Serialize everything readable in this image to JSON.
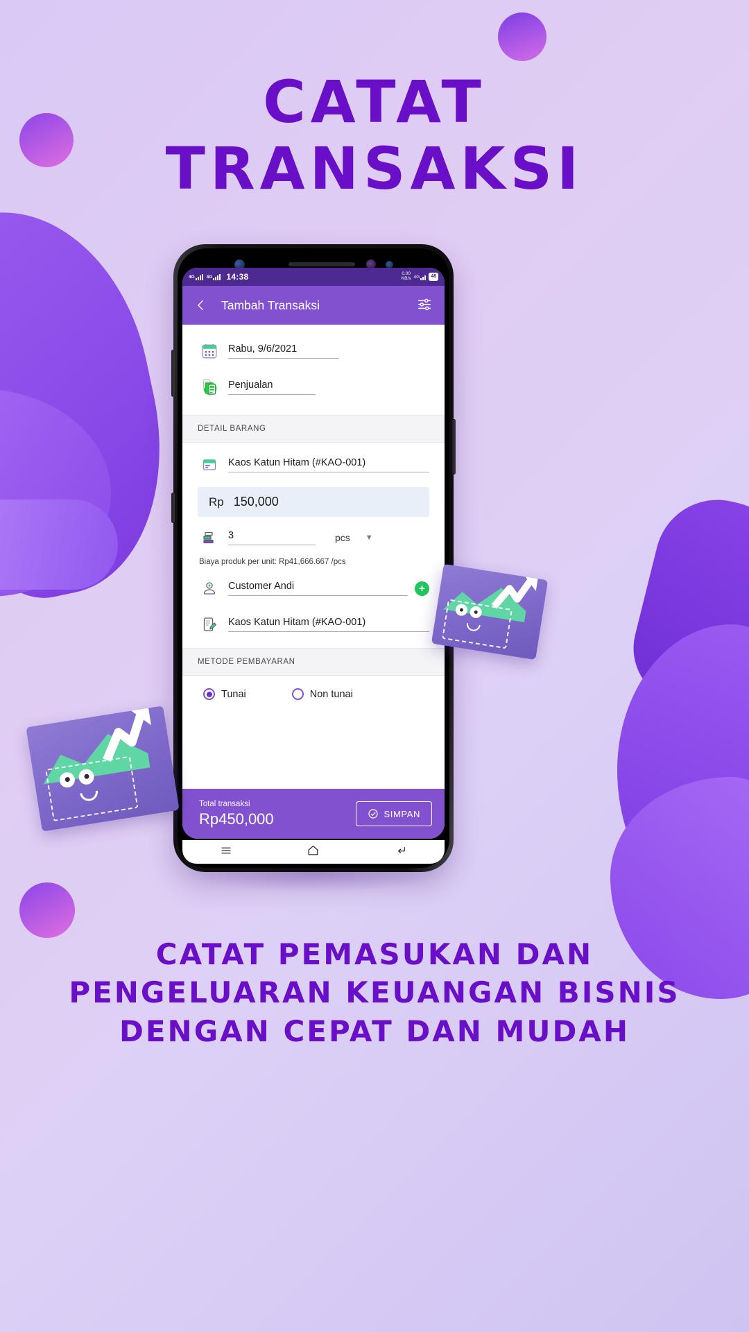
{
  "poster": {
    "headline_line1": "CATAT",
    "headline_line2": "TRANSAKSI",
    "caption_line1": "CATAT PEMASUKAN DAN",
    "caption_line2": "PENGELUARAN KEUANGAN BISNIS",
    "caption_line3": "DENGAN CEPAT DAN MUDAH",
    "brand_purple": "#6a0fc8",
    "background_start": "#d9c9f5",
    "background_end": "#cfc3f2"
  },
  "phone": {
    "status_bar": {
      "network_1": "4G",
      "network_2": "4G",
      "time": "14:38",
      "data_rate_value": "0.00",
      "data_rate_unit": "KB/s",
      "network_right": "4G",
      "battery": "48",
      "background": "#4d2a92"
    },
    "app_bar": {
      "back_icon": "chevron-left-icon",
      "title": "Tambah Transaksi",
      "filter_icon": "tune-sliders-icon",
      "background": "#8251d0"
    },
    "form": {
      "date_icon": "calendar-icon",
      "date_value": "Rabu, 9/6/2021",
      "category_icon": "invoice-icon",
      "category_value": "Penjualan",
      "section_item_header": "DETAIL BARANG",
      "item_icon": "box-icon",
      "item_value": "Kaos Katun Hitam (#KAO-001)",
      "price_currency": "Rp",
      "price_value": "150,000",
      "qty_icon": "stack-icon",
      "qty_value": "3",
      "qty_unit": "pcs",
      "qty_unit_caret": "chevron-down-icon",
      "cost_note": "Biaya produk per unit: Rp41,666.667 /pcs",
      "customer_icon": "customer-icon",
      "customer_value": "Customer Andi",
      "add_customer_icon": "plus-icon",
      "description_icon": "note-edit-icon",
      "description_value": "Kaos Katun Hitam (#KAO-001)",
      "section_payment_header": "METODE PEMBAYARAN",
      "payment_options": [
        {
          "label": "Tunai",
          "selected": true
        },
        {
          "label": "Non tunai",
          "selected": false
        }
      ]
    },
    "total_bar": {
      "label": "Total transaksi",
      "amount": "Rp450,000",
      "save_icon": "check-circle-icon",
      "save_label": "SIMPAN"
    },
    "nav_bar": {
      "recents_icon": "menu-icon",
      "home_icon": "home-icon",
      "back_icon": "back-arrow-icon"
    }
  }
}
